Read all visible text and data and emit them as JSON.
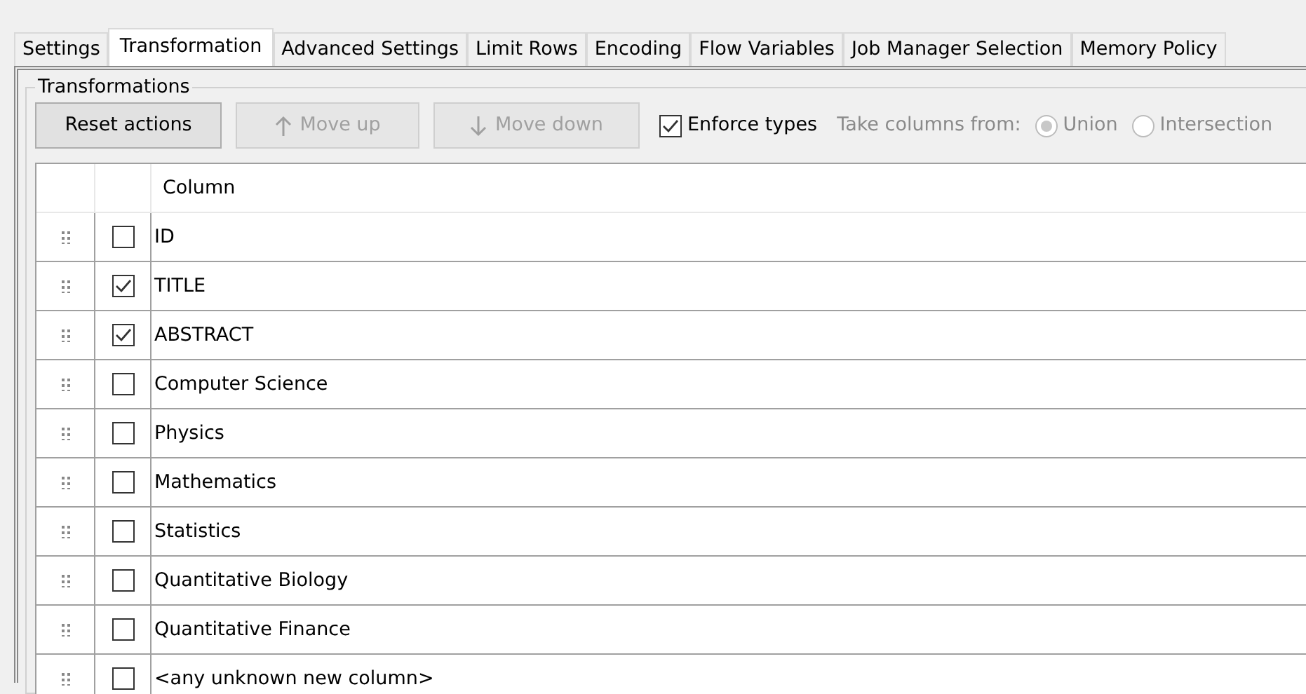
{
  "tabs": [
    {
      "label": "Settings",
      "selected": false
    },
    {
      "label": "Transformation",
      "selected": true
    },
    {
      "label": "Advanced Settings",
      "selected": false
    },
    {
      "label": "Limit Rows",
      "selected": false
    },
    {
      "label": "Encoding",
      "selected": false
    },
    {
      "label": "Flow Variables",
      "selected": false
    },
    {
      "label": "Job Manager Selection",
      "selected": false
    },
    {
      "label": "Memory Policy",
      "selected": false
    }
  ],
  "group_title": "Transformations",
  "buttons": [
    {
      "label": "Reset actions",
      "disabled": false,
      "kind": "plain"
    },
    {
      "label": "Move up",
      "disabled": true,
      "kind": "up"
    },
    {
      "label": "Move down",
      "disabled": true,
      "kind": "down"
    }
  ],
  "enforce_types": {
    "label": "Enforce types",
    "checked": true
  },
  "take_columns": {
    "label": "Take columns from:",
    "disabled": true,
    "options": [
      {
        "label": "Union",
        "selected": true
      },
      {
        "label": "Intersection",
        "selected": false
      }
    ]
  },
  "table": {
    "columns": [
      "Column"
    ],
    "rows": [
      {
        "name": "ID",
        "checked": false
      },
      {
        "name": "TITLE",
        "checked": true
      },
      {
        "name": "ABSTRACT",
        "checked": true
      },
      {
        "name": "Computer Science",
        "checked": false
      },
      {
        "name": "Physics",
        "checked": false
      },
      {
        "name": "Mathematics",
        "checked": false
      },
      {
        "name": "Statistics",
        "checked": false
      },
      {
        "name": "Quantitative Biology",
        "checked": false
      },
      {
        "name": "Quantitative Finance",
        "checked": false
      },
      {
        "name": "<any unknown new column>",
        "checked": false
      }
    ]
  }
}
